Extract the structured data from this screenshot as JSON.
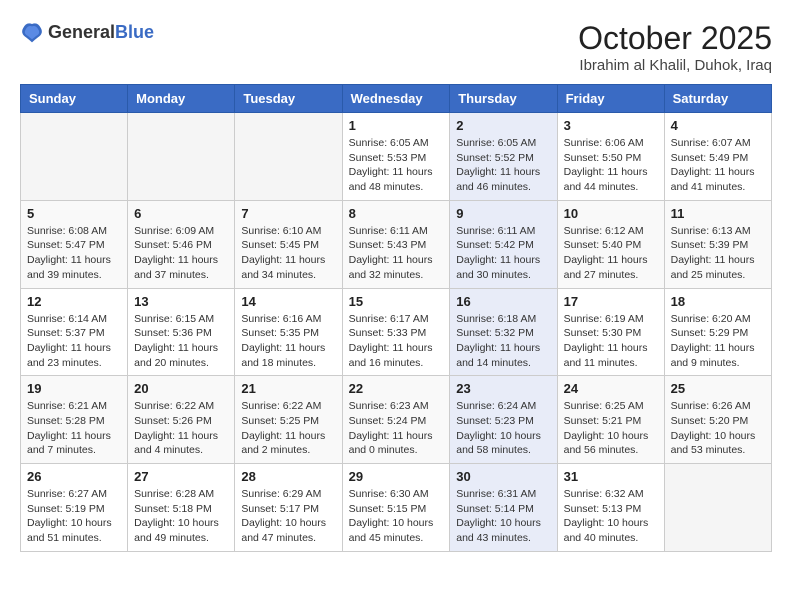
{
  "header": {
    "logo": {
      "general": "General",
      "blue": "Blue"
    },
    "title": "October 2025",
    "location": "Ibrahim al Khalil, Duhok, Iraq"
  },
  "calendar": {
    "weekdays": [
      "Sunday",
      "Monday",
      "Tuesday",
      "Wednesday",
      "Thursday",
      "Friday",
      "Saturday"
    ],
    "weeks": [
      [
        {
          "day": "",
          "info": ""
        },
        {
          "day": "",
          "info": ""
        },
        {
          "day": "",
          "info": ""
        },
        {
          "day": "1",
          "info": "Sunrise: 6:05 AM\nSunset: 5:53 PM\nDaylight: 11 hours\nand 48 minutes."
        },
        {
          "day": "2",
          "info": "Sunrise: 6:05 AM\nSunset: 5:52 PM\nDaylight: 11 hours\nand 46 minutes."
        },
        {
          "day": "3",
          "info": "Sunrise: 6:06 AM\nSunset: 5:50 PM\nDaylight: 11 hours\nand 44 minutes."
        },
        {
          "day": "4",
          "info": "Sunrise: 6:07 AM\nSunset: 5:49 PM\nDaylight: 11 hours\nand 41 minutes."
        }
      ],
      [
        {
          "day": "5",
          "info": "Sunrise: 6:08 AM\nSunset: 5:47 PM\nDaylight: 11 hours\nand 39 minutes."
        },
        {
          "day": "6",
          "info": "Sunrise: 6:09 AM\nSunset: 5:46 PM\nDaylight: 11 hours\nand 37 minutes."
        },
        {
          "day": "7",
          "info": "Sunrise: 6:10 AM\nSunset: 5:45 PM\nDaylight: 11 hours\nand 34 minutes."
        },
        {
          "day": "8",
          "info": "Sunrise: 6:11 AM\nSunset: 5:43 PM\nDaylight: 11 hours\nand 32 minutes."
        },
        {
          "day": "9",
          "info": "Sunrise: 6:11 AM\nSunset: 5:42 PM\nDaylight: 11 hours\nand 30 minutes."
        },
        {
          "day": "10",
          "info": "Sunrise: 6:12 AM\nSunset: 5:40 PM\nDaylight: 11 hours\nand 27 minutes."
        },
        {
          "day": "11",
          "info": "Sunrise: 6:13 AM\nSunset: 5:39 PM\nDaylight: 11 hours\nand 25 minutes."
        }
      ],
      [
        {
          "day": "12",
          "info": "Sunrise: 6:14 AM\nSunset: 5:37 PM\nDaylight: 11 hours\nand 23 minutes."
        },
        {
          "day": "13",
          "info": "Sunrise: 6:15 AM\nSunset: 5:36 PM\nDaylight: 11 hours\nand 20 minutes."
        },
        {
          "day": "14",
          "info": "Sunrise: 6:16 AM\nSunset: 5:35 PM\nDaylight: 11 hours\nand 18 minutes."
        },
        {
          "day": "15",
          "info": "Sunrise: 6:17 AM\nSunset: 5:33 PM\nDaylight: 11 hours\nand 16 minutes."
        },
        {
          "day": "16",
          "info": "Sunrise: 6:18 AM\nSunset: 5:32 PM\nDaylight: 11 hours\nand 14 minutes."
        },
        {
          "day": "17",
          "info": "Sunrise: 6:19 AM\nSunset: 5:30 PM\nDaylight: 11 hours\nand 11 minutes."
        },
        {
          "day": "18",
          "info": "Sunrise: 6:20 AM\nSunset: 5:29 PM\nDaylight: 11 hours\nand 9 minutes."
        }
      ],
      [
        {
          "day": "19",
          "info": "Sunrise: 6:21 AM\nSunset: 5:28 PM\nDaylight: 11 hours\nand 7 minutes."
        },
        {
          "day": "20",
          "info": "Sunrise: 6:22 AM\nSunset: 5:26 PM\nDaylight: 11 hours\nand 4 minutes."
        },
        {
          "day": "21",
          "info": "Sunrise: 6:22 AM\nSunset: 5:25 PM\nDaylight: 11 hours\nand 2 minutes."
        },
        {
          "day": "22",
          "info": "Sunrise: 6:23 AM\nSunset: 5:24 PM\nDaylight: 11 hours\nand 0 minutes."
        },
        {
          "day": "23",
          "info": "Sunrise: 6:24 AM\nSunset: 5:23 PM\nDaylight: 10 hours\nand 58 minutes."
        },
        {
          "day": "24",
          "info": "Sunrise: 6:25 AM\nSunset: 5:21 PM\nDaylight: 10 hours\nand 56 minutes."
        },
        {
          "day": "25",
          "info": "Sunrise: 6:26 AM\nSunset: 5:20 PM\nDaylight: 10 hours\nand 53 minutes."
        }
      ],
      [
        {
          "day": "26",
          "info": "Sunrise: 6:27 AM\nSunset: 5:19 PM\nDaylight: 10 hours\nand 51 minutes."
        },
        {
          "day": "27",
          "info": "Sunrise: 6:28 AM\nSunset: 5:18 PM\nDaylight: 10 hours\nand 49 minutes."
        },
        {
          "day": "28",
          "info": "Sunrise: 6:29 AM\nSunset: 5:17 PM\nDaylight: 10 hours\nand 47 minutes."
        },
        {
          "day": "29",
          "info": "Sunrise: 6:30 AM\nSunset: 5:15 PM\nDaylight: 10 hours\nand 45 minutes."
        },
        {
          "day": "30",
          "info": "Sunrise: 6:31 AM\nSunset: 5:14 PM\nDaylight: 10 hours\nand 43 minutes."
        },
        {
          "day": "31",
          "info": "Sunrise: 6:32 AM\nSunset: 5:13 PM\nDaylight: 10 hours\nand 40 minutes."
        },
        {
          "day": "",
          "info": ""
        }
      ]
    ]
  }
}
